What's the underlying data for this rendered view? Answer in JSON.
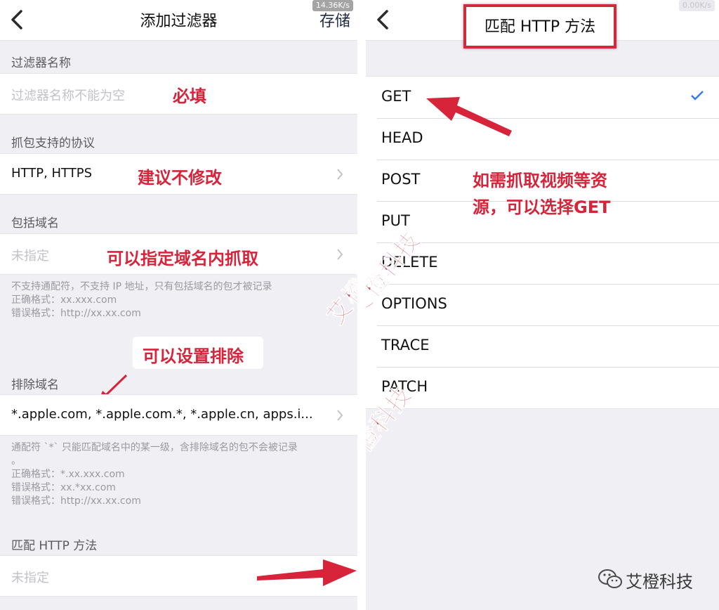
{
  "left": {
    "nav": {
      "title": "添加过滤器",
      "save_label": "存储",
      "speed": "14.36K/s"
    },
    "filter_name": {
      "section": "过滤器名称",
      "placeholder": "过滤器名称不能为空",
      "annotation": "必填"
    },
    "protocols": {
      "section": "抓包支持的协议",
      "value": "HTTP, HTTPS",
      "annotation": "建议不修改"
    },
    "include_domains": {
      "section": "包括域名",
      "value": "未指定",
      "annotation": "可以指定域名内抓取",
      "help": [
        "不支持通配符，不支持 IP 地址，只有包括域名的包才被记录",
        "正确格式：xx.xxx.com",
        "错误格式：http://xx.xx.com"
      ]
    },
    "exclude_annotation": "可以设置排除",
    "exclude_domains": {
      "section": "排除域名",
      "value": "*.apple.com, *.apple.com.*, *.apple.cn, apps.i...",
      "help": [
        "通配符 `*` 只能匹配域名中的某一级，含排除域名的包不会被记录",
        "。",
        "正确格式：*.xx.xxx.com",
        "错误格式：xx.*xx.com",
        "错误格式：http://xx.xx.com"
      ]
    },
    "http_method": {
      "section": "匹配 HTTP 方法",
      "value": "未指定"
    },
    "watermark": "艾橙科技"
  },
  "right": {
    "nav": {
      "title": "匹配 HTTP 方法",
      "speed": "0.00K/s"
    },
    "methods": [
      "GET",
      "HEAD",
      "POST",
      "PUT",
      "DELETE",
      "OPTIONS",
      "TRACE",
      "PATCH"
    ],
    "selected_method": "GET",
    "annotation_lines": [
      "如需抓取视频等资",
      "源，可以选择GET"
    ],
    "watermarks": [
      "艾橙科技",
      "艾橙科技"
    ],
    "footer": "艾橙科技"
  },
  "colors": {
    "annotation_red": "#d7243a",
    "check_blue": "#3478f6",
    "background": "#efeff4"
  }
}
